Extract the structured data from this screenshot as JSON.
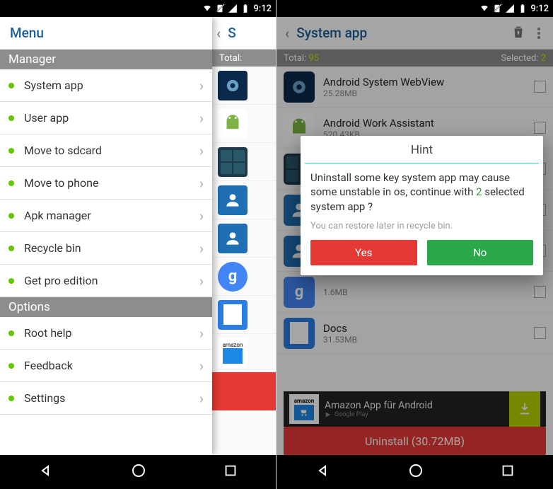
{
  "statusbar": {
    "time": "9:12"
  },
  "screen1": {
    "drawer": {
      "title": "Menu",
      "sections": [
        {
          "header": "Manager",
          "items": [
            "System app",
            "User app",
            "Move to sdcard",
            "Move to phone",
            "Apk manager",
            "Recycle bin",
            "Get pro edition"
          ]
        },
        {
          "header": "Options",
          "items": [
            "Root help",
            "Feedback",
            "Settings"
          ]
        }
      ]
    },
    "peek": {
      "title_partial": "S",
      "counts_label": "Total:"
    }
  },
  "screen2": {
    "actionbar": {
      "title": "System app"
    },
    "counts": {
      "total_label": "Total:",
      "total_value": "95",
      "selected_label": "Selected:",
      "selected_value": "2"
    },
    "apps": [
      {
        "name": "Android System WebView",
        "size": "25.28MB",
        "icon": "gear"
      },
      {
        "name": "Android Work Assistant",
        "size": "520.43KB",
        "icon": "droid"
      },
      {
        "name": "",
        "size": "",
        "icon": "calc"
      },
      {
        "name": "",
        "size": "",
        "icon": "contact"
      },
      {
        "name": "",
        "size": "",
        "icon": "contact"
      },
      {
        "name": "",
        "size": "1.6MB",
        "icon": "g"
      },
      {
        "name": "Docs",
        "size": "31.53MB",
        "icon": "doc"
      }
    ],
    "ad": {
      "title": "Amazon App für Android",
      "store_hint": "Google Play",
      "brand": "amazon"
    },
    "uninstall_label": "Uninstall (30.72MB)",
    "dialog": {
      "title": "Hint",
      "body_p1": "Uninstall some key system app may cause some unstable in os, continue with ",
      "body_count": "2",
      "body_p2": " selected system app ?",
      "sub": "You can restore later in recycle bin.",
      "yes": "Yes",
      "no": "No"
    }
  }
}
